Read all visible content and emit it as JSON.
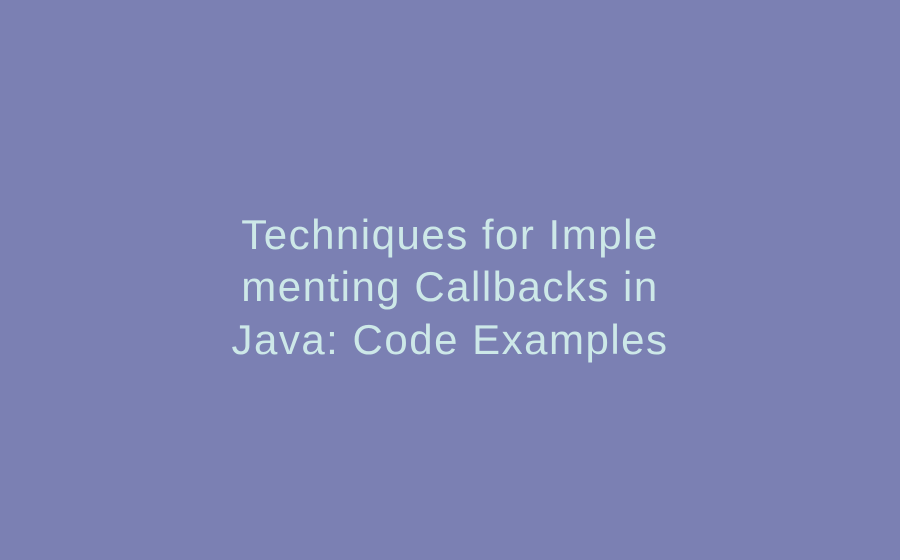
{
  "title": {
    "line1": "Techniques for Imple",
    "line2": "menting Callbacks in",
    "line3": " Java: Code Examples"
  },
  "colors": {
    "background": "#7b80b3",
    "text": "#cde8e8"
  }
}
